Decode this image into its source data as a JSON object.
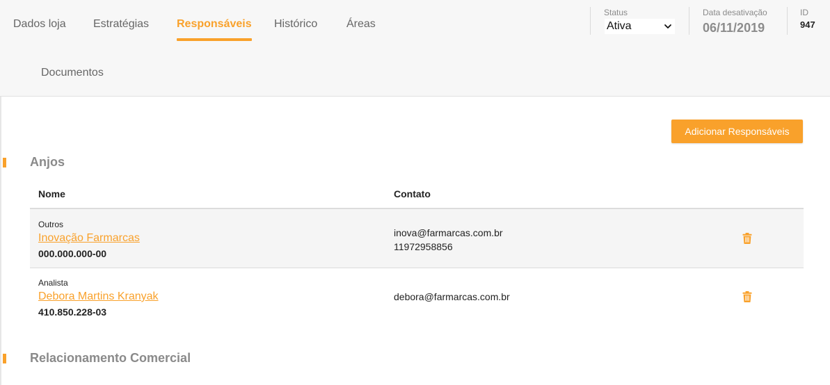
{
  "tabs": [
    {
      "label": "Dados loja",
      "active": false
    },
    {
      "label": "Estratégias",
      "active": false
    },
    {
      "label": "Responsáveis",
      "active": true
    },
    {
      "label": "Histórico",
      "active": false
    },
    {
      "label": "Áreas",
      "active": false
    },
    {
      "label": "Documentos",
      "active": false
    }
  ],
  "meta": {
    "status_label": "Status",
    "status_value": "Ativa",
    "deactivation_label": "Data desativação",
    "deactivation_value": "06/11/2019",
    "id_label": "ID",
    "id_value": "947"
  },
  "actions": {
    "add_label": "Adicionar Responsáveis"
  },
  "sections": {
    "anjos": {
      "title": "Anjos",
      "columns": [
        "Nome",
        "Contato"
      ],
      "rows": [
        {
          "role": "Outros",
          "name": "Inovação Farmarcas",
          "document": "000.000.000-00",
          "email": "inova@farmarcas.com.br",
          "phone": "11972958856"
        },
        {
          "role": "Analista",
          "name": "Debora Martins Kranyak",
          "document": "410.850.228-03",
          "email": "debora@farmarcas.com.br",
          "phone": ""
        }
      ]
    },
    "relacionamento": {
      "title": "Relacionamento Comercial"
    }
  },
  "colors": {
    "accent": "#f9a12b",
    "header_bg": "#f7f7f7",
    "muted_text": "#8a8a8a"
  }
}
